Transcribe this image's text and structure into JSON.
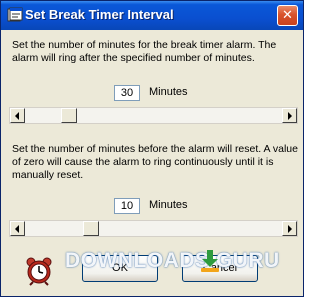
{
  "window": {
    "title": "Set Break Timer Interval",
    "icons": {
      "title": "timer-app-icon",
      "close": "close-icon"
    },
    "close_glyph": "✕"
  },
  "alarm_section": {
    "description": "Set the number of minutes for the break timer alarm.  The alarm will ring after the specified number of minutes.",
    "minutes_value": "30",
    "unit_label": "Minutes",
    "slider_fraction": 0.15
  },
  "reset_section": {
    "description": "Set the number of minutes before the alarm will reset.  A value of zero will cause the alarm to ring continuously until  it is manually reset.",
    "minutes_value": "10",
    "unit_label": "Minutes",
    "slider_fraction": 0.24
  },
  "footer": {
    "icon": "alarm-clock-icon",
    "ok_label": "OK",
    "cancel_label": "Cancel"
  },
  "watermark": {
    "text": "DOWNLOADS  GURU",
    "icon": "download-arrow-icon"
  },
  "colors": {
    "title_bar": "#0a4fd0",
    "window_bg": "#ece9d8",
    "close_button": "#d9532c"
  }
}
